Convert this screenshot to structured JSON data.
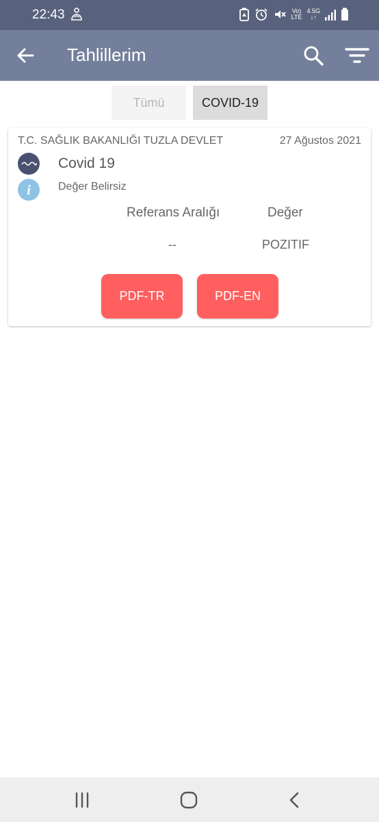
{
  "status_bar": {
    "time": "22:43",
    "network_top": "4.5G",
    "volte_label": "Vo)",
    "lte_label": "LTE"
  },
  "app_bar": {
    "title": "Tahlillerim",
    "back_icon": "arrow-left-icon",
    "search_icon": "search-icon",
    "filter_icon": "filter-icon"
  },
  "tabs": [
    {
      "label": "Tümü",
      "active": false
    },
    {
      "label": "COVID-19",
      "active": true
    }
  ],
  "result_card": {
    "hospital": "T.C. SAĞLIK BAKANLIĞI TUZLA DEVLET",
    "date": "27 Ağustos 2021",
    "test_name": "Covid 19",
    "status": "Değer Belirsiz",
    "reference_header": "Referans Aralığı",
    "value_header": "Değer",
    "reference_value": "--",
    "value": "POZITIF",
    "pdf_tr_label": "PDF-TR",
    "pdf_en_label": "PDF-EN"
  },
  "colors": {
    "status_bar": "#58627d",
    "app_bar": "#747f9b",
    "pdf_button": "#ff5f5f",
    "wave_icon_bg": "#4a5170",
    "info_icon_bg": "#8fc3e6"
  }
}
